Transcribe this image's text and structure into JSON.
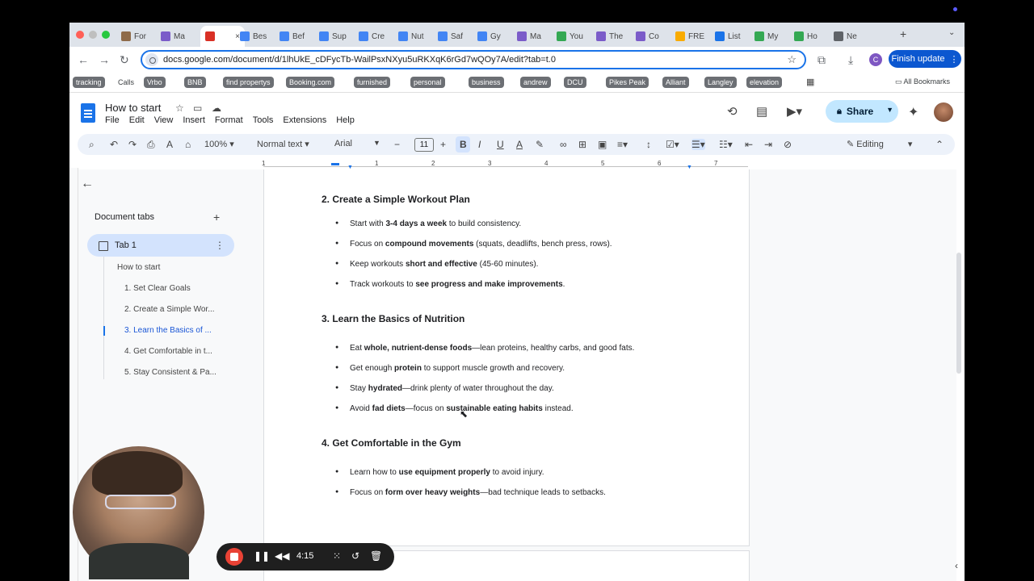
{
  "browser": {
    "tabs": [
      "For",
      "Ma",
      "",
      "Bes",
      "Bef",
      "Sup",
      "Cre",
      "Nut",
      "Saf",
      "Gy",
      "Ma",
      "You",
      "The",
      "Co",
      "FRE",
      "List",
      "My",
      "Ho",
      "Ne"
    ],
    "url": "docs.google.com/document/d/1lhUkE_cDFycTb-WailPsxNXyu5uRKXqK6rGd7wQOy7A/edit?tab=t.0",
    "finish_update": "Finish update",
    "bookmarks": [
      "tracking",
      "Calls",
      "Vrbo",
      "BNB",
      "find propertys",
      "Booking.com",
      "furnished",
      "personal",
      "business",
      "andrew",
      "DCU",
      "Pikes Peak",
      "Alliant",
      "Langley",
      "elevation"
    ],
    "all_bookmarks": "All Bookmarks"
  },
  "docs": {
    "title": "How to start",
    "menus": [
      "File",
      "Edit",
      "View",
      "Insert",
      "Format",
      "Tools",
      "Extensions",
      "Help"
    ],
    "share": "Share",
    "toolbar": {
      "zoom": "100%",
      "style": "Normal text",
      "font": "Arial",
      "size": "11",
      "mode": "Editing"
    },
    "ruler": [
      "1",
      "1",
      "2",
      "3",
      "4",
      "5",
      "6",
      "7"
    ]
  },
  "outline": {
    "header": "Document tabs",
    "tab": "Tab 1",
    "items": [
      "How to start",
      "1. Set Clear Goals",
      "2. Create a Simple Wor...",
      "3. Learn the Basics of ...",
      "4. Get Comfortable in t...",
      "5. Stay Consistent & Pa..."
    ]
  },
  "document": {
    "sec2_title": "2. Create a Simple Workout Plan",
    "sec2": [
      {
        "a": "Start with ",
        "b": "3-4 days a week",
        "c": " to build consistency."
      },
      {
        "a": "Focus on ",
        "b": "compound movements",
        "c": " (squats, deadlifts, bench press, rows)."
      },
      {
        "a": "Keep workouts ",
        "b": "short and effective",
        "c": " (45-60 minutes)."
      },
      {
        "a": "Track workouts to ",
        "b": "see progress and make improvements",
        "c": "."
      }
    ],
    "sec3_title": "3. Learn the Basics of Nutrition",
    "sec3": [
      {
        "a": "Eat ",
        "b": "whole, nutrient-dense foods",
        "c": "—lean proteins, healthy carbs, and good fats."
      },
      {
        "a": "Get enough ",
        "b": "protein",
        "c": " to support muscle growth and recovery."
      },
      {
        "a": "Stay ",
        "b": "hydrated",
        "c": "—drink plenty of water throughout the day."
      },
      {
        "a": "Avoid ",
        "b": "fad diets",
        "c": "—focus on ",
        "d": "sustainable eating habits",
        "e": " instead."
      }
    ],
    "sec4_title": "4. Get Comfortable in the Gym",
    "sec4": [
      {
        "a": "Learn how to ",
        "b": "use equipment properly",
        "c": " to avoid injury."
      },
      {
        "a": "Focus on ",
        "b": "form over heavy weights",
        "c": "—bad technique leads to setbacks."
      }
    ]
  },
  "recorder": {
    "time": "4:15"
  },
  "colors": {
    "accent": "#1a73e8",
    "share_bg": "#c2e7ff",
    "record": "#e94235"
  }
}
